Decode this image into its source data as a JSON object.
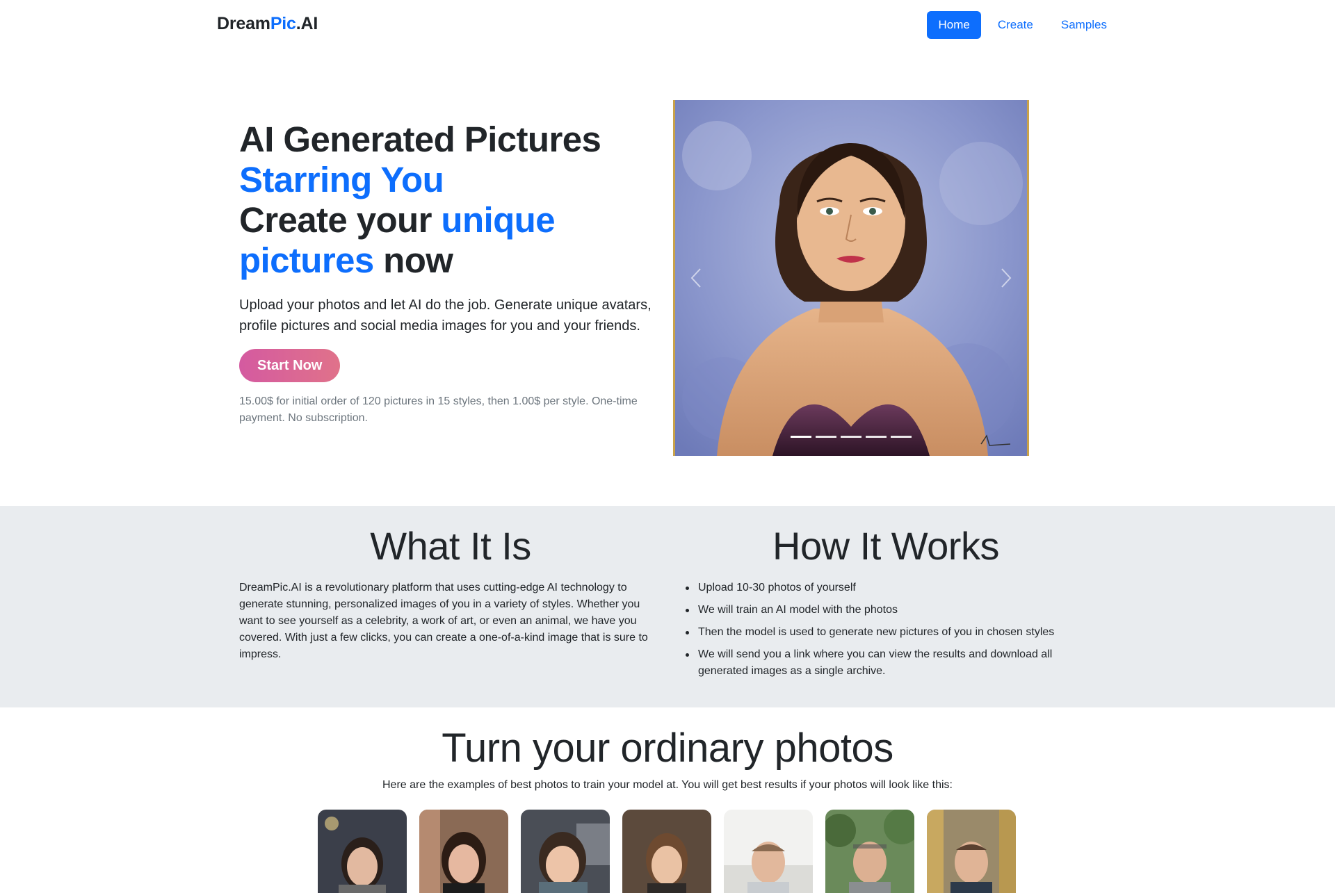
{
  "brand": {
    "part1": "Dream",
    "part2": "Pic",
    "part3": ".AI"
  },
  "nav": {
    "home": "Home",
    "create": "Create",
    "samples": "Samples"
  },
  "hero": {
    "line1": "AI Generated Pictures",
    "line2": "Starring You",
    "line3a": "Create your ",
    "line3b": "unique",
    "line4a": "pictures",
    "line4b": " now",
    "lead": "Upload your photos and let AI do the job. Generate unique avatars, profile pictures and social media images for you and your friends.",
    "cta": "Start Now",
    "price_note": "15.00$ for initial order of 120 pictures in 15 styles, then 1.00$ per style. One-time payment. No subscription."
  },
  "carousel": {
    "slide_count": 5,
    "active_index": 0
  },
  "what": {
    "title": "What It Is",
    "body": "DreamPic.AI is a revolutionary platform that uses cutting-edge AI technology to generate stunning, personalized images of you in a variety of styles. Whether you want to see yourself as a celebrity, a work of art, or even an animal, we have you covered. With just a few clicks, you can create a one-of-a-kind image that is sure to impress."
  },
  "how": {
    "title": "How It Works",
    "steps": [
      "Upload 10-30 photos of yourself",
      "We will train an AI model with the photos",
      "Then the model is used to generate new pictures of you in chosen styles",
      "We will send you a link where you can view the results and download all generated images as a single archive."
    ]
  },
  "examples": {
    "title": "Turn your ordinary photos",
    "subtitle": "Here are the examples of best photos to train your model at. You will get best results if your photos will look like this:",
    "photo_count": 7
  },
  "colors": {
    "accent": "#0d6efd",
    "section_bg": "#e9ecef",
    "cta_start": "#d45aa0",
    "cta_end": "#e0728a"
  }
}
